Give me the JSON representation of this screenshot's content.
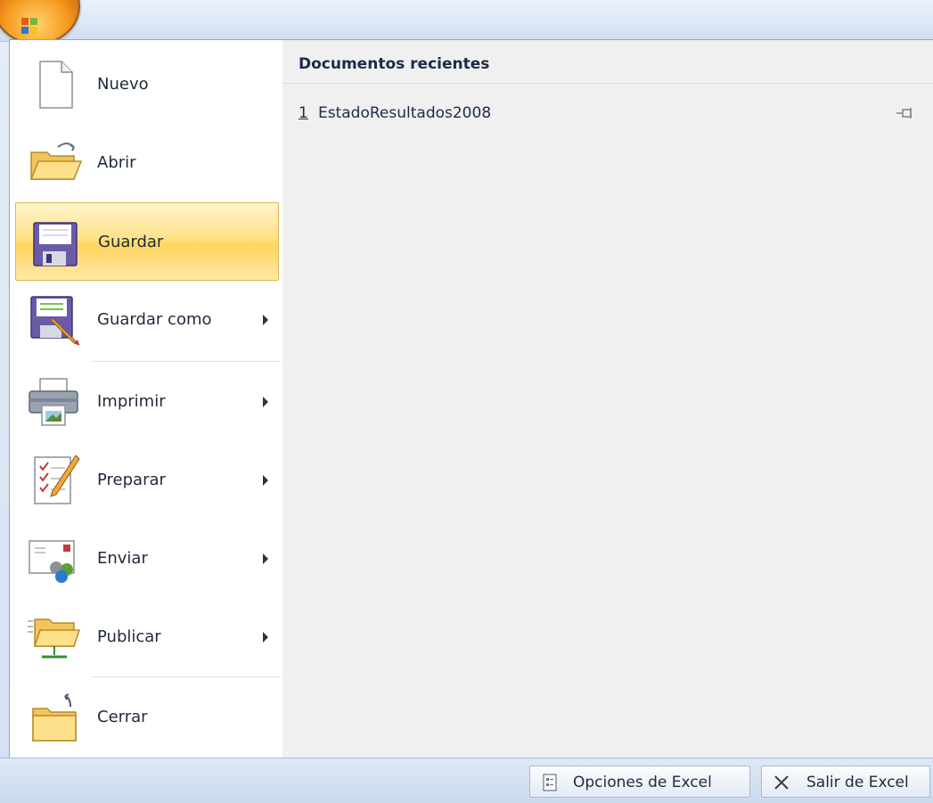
{
  "menu": {
    "items": [
      {
        "key": "nuevo",
        "label": "Nuevo",
        "icon": "new-document-icon",
        "submenu": false,
        "active": false
      },
      {
        "key": "abrir",
        "label": "Abrir",
        "icon": "open-folder-icon",
        "submenu": false,
        "active": false
      },
      {
        "key": "guardar",
        "label": "Guardar",
        "icon": "save-floppy-icon",
        "submenu": false,
        "active": true
      },
      {
        "key": "guardar-como",
        "label": "Guardar como",
        "icon": "save-as-icon",
        "submenu": true,
        "active": false
      },
      {
        "key": "imprimir",
        "label": "Imprimir",
        "icon": "printer-icon",
        "submenu": true,
        "active": false
      },
      {
        "key": "preparar",
        "label": "Preparar",
        "icon": "prepare-document-icon",
        "submenu": true,
        "active": false
      },
      {
        "key": "enviar",
        "label": "Enviar",
        "icon": "send-icon",
        "submenu": true,
        "active": false
      },
      {
        "key": "publicar",
        "label": "Publicar",
        "icon": "publish-folder-icon",
        "submenu": true,
        "active": false
      },
      {
        "key": "cerrar",
        "label": "Cerrar",
        "icon": "close-folder-icon",
        "submenu": false,
        "active": false
      }
    ]
  },
  "recent": {
    "title": "Documentos recientes",
    "items": [
      {
        "number": "1",
        "name": "EstadoResultados2008",
        "icon": "pin-icon"
      }
    ]
  },
  "footer": {
    "options_label": "Opciones de Excel",
    "exit_label": "Salir de Excel"
  },
  "colors": {
    "active_highlight": "#ffd55e",
    "frame_blue": "#d3e1f2",
    "office_orange": "#f59a1e"
  }
}
